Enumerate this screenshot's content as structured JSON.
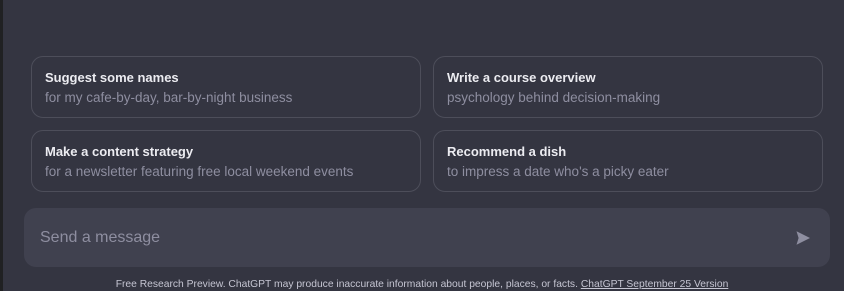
{
  "suggestions": [
    {
      "title": "Suggest some names",
      "subtitle": "for my cafe-by-day, bar-by-night business"
    },
    {
      "title": "Write a course overview",
      "subtitle": "psychology behind decision-making"
    },
    {
      "title": "Make a content strategy",
      "subtitle": "for a newsletter featuring free local weekend events"
    },
    {
      "title": "Recommend a dish",
      "subtitle": "to impress a date who's a picky eater"
    }
  ],
  "composer": {
    "placeholder": "Send a message",
    "value": ""
  },
  "disclaimer": {
    "text": "Free Research Preview. ChatGPT may produce inaccurate information about people, places, or facts. ",
    "link_label": "ChatGPT September 25 Version"
  },
  "colors": {
    "background": "#343541",
    "composer": "#40414f",
    "card_border": "#4d4e5a",
    "title_text": "#ececf1",
    "muted_text": "#8e8ea0"
  },
  "icons": {
    "send": "send-icon"
  }
}
